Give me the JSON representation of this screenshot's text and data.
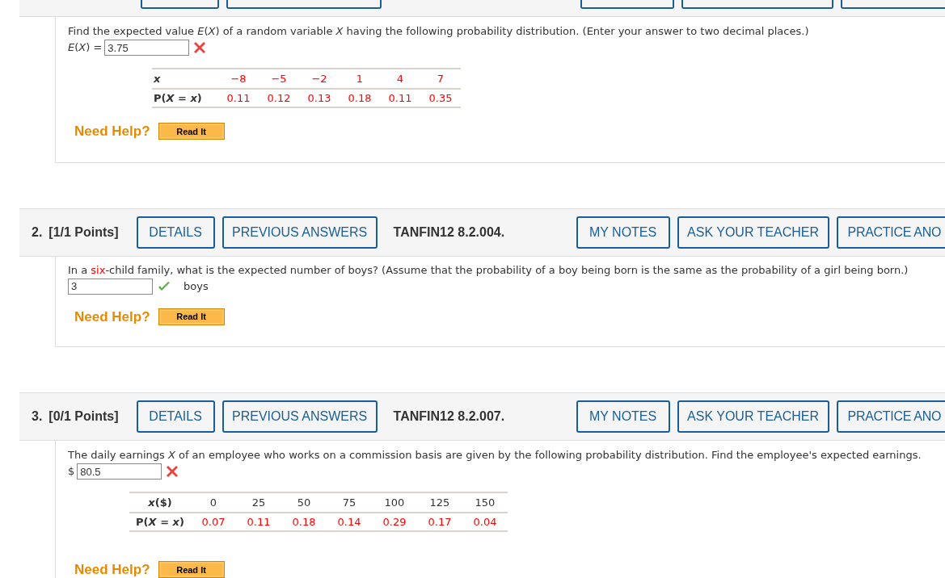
{
  "previous_header": {
    "buttons": [
      {
        "kind": "left"
      },
      {
        "kind": "left"
      },
      {
        "kind": "right"
      },
      {
        "kind": "right"
      },
      {
        "kind": "right"
      }
    ]
  },
  "questions": [
    {
      "prompt": [
        {
          "text": "Find the expected value *E*(*X*) of a random variable *X* having the following probability distribution. (Enter your answer to two decimal places.)",
          "emphasized": false
        }
      ],
      "answer": {
        "prefix": "*E*(*X*) =",
        "value": "3.75",
        "correct": false
      },
      "table": {
        "rows": [
          {
            "label": "*x*",
            "emphasized": true,
            "cells": [
              "−8",
              "−5",
              "−2",
              "1",
              "4",
              "7"
            ]
          },
          {
            "label": "P(*X* = *x*)",
            "emphasized": true,
            "cells": [
              "0.11",
              "0.12",
              "0.13",
              "0.18",
              "0.11",
              "0.35"
            ]
          }
        ]
      },
      "help": {
        "label": "Need Help?",
        "button": "Read It"
      }
    },
    {
      "header": {
        "number": "2.",
        "points": "[1/1 Points]",
        "left_buttons": [
          "DETAILS",
          "PREVIOUS ANSWERS"
        ],
        "code": "TANFIN12 8.2.004.",
        "right_buttons": [
          "MY NOTES",
          "ASK YOUR TEACHER",
          "PRACTICE ANO"
        ]
      },
      "prompt": [
        {
          "text": "In a ",
          "emphasized": false
        },
        {
          "text": "six",
          "emphasized": true
        },
        {
          "text": "-child family, what is the expected number of boys? (Assume that the probability of a boy being born is the same as the probability of a girl being born.)",
          "emphasized": false
        }
      ],
      "answer": {
        "value": "3",
        "correct": true,
        "suffix": "boys"
      },
      "help": {
        "label": "Need Help?",
        "button": "Read It"
      }
    },
    {
      "header": {
        "number": "3.",
        "points": "[0/1 Points]",
        "left_buttons": [
          "DETAILS",
          "PREVIOUS ANSWERS"
        ],
        "code": "TANFIN12 8.2.007.",
        "right_buttons": [
          "MY NOTES",
          "ASK YOUR TEACHER",
          "PRACTICE ANO"
        ]
      },
      "prompt": [
        {
          "text": "The daily earnings *X* of an employee who works on a commission basis are given by the following probability distribution. Find the employee's expected earnings.",
          "emphasized": false
        }
      ],
      "answer": {
        "prefix": "$",
        "value": "80.5",
        "correct": false
      },
      "table": {
        "rows": [
          {
            "label": "*x*($)",
            "emphasized": false,
            "cells": [
              "0",
              "25",
              "50",
              "75",
              "100",
              "125",
              "150"
            ]
          },
          {
            "label": "P(*X* = *x*)",
            "emphasized": true,
            "cells": [
              "0.07",
              "0.11",
              "0.18",
              "0.14",
              "0.29",
              "0.17",
              "0.04"
            ]
          }
        ]
      },
      "help": {
        "label": "Need Help?",
        "button": "Read It"
      }
    }
  ]
}
